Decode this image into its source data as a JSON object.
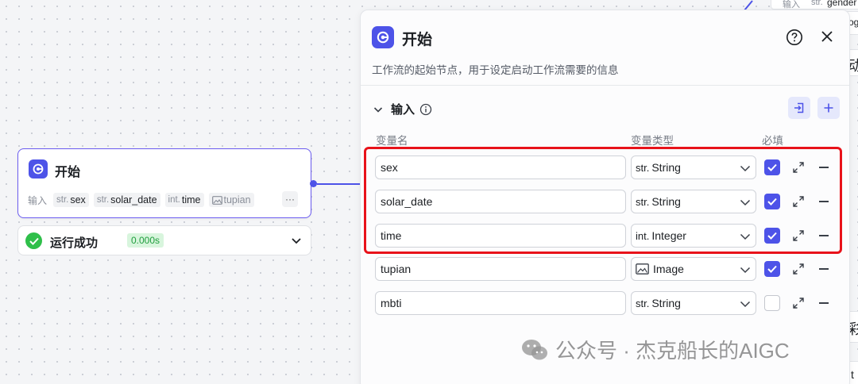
{
  "node": {
    "title": "开始",
    "inputs_label": "输入",
    "chips": [
      {
        "type": "str.",
        "name": "sex"
      },
      {
        "type": "str.",
        "name": "solar_date"
      },
      {
        "type": "int.",
        "name": "time"
      },
      {
        "type": "img",
        "name": "tupian"
      }
    ],
    "more": "···"
  },
  "status": {
    "text": "运行成功",
    "time": "0.000s"
  },
  "bg_fragments": {
    "input_label": "输入",
    "type_prefix": "str.",
    "gender": "gender",
    "og": "og",
    "char1": "动",
    "char2": "彩",
    "char3": "t"
  },
  "panel": {
    "title": "开始",
    "description": "工作流的起始节点，用于设定启动工作流需要的信息",
    "section": "输入",
    "columns": {
      "name": "变量名",
      "type": "变量类型",
      "required": "必填"
    },
    "rows": [
      {
        "name": "sex",
        "type_prefix": "str.",
        "type": "String",
        "type_icon": "string-icon",
        "required": true
      },
      {
        "name": "solar_date",
        "type_prefix": "str.",
        "type": "String",
        "type_icon": "string-icon",
        "required": true
      },
      {
        "name": "time",
        "type_prefix": "int.",
        "type": "Integer",
        "type_icon": "integer-icon",
        "required": true
      },
      {
        "name": "tupian",
        "type_prefix": "",
        "type": "Image",
        "type_icon": "image-icon",
        "required": true
      },
      {
        "name": "mbti",
        "type_prefix": "str.",
        "type": "String",
        "type_icon": "string-icon",
        "required": false
      }
    ]
  },
  "watermark": "公众号 · 杰克船长的AIGC",
  "colors": {
    "accent": "#4d53e8",
    "highlight": "#e8121a",
    "success": "#2fbf4a"
  }
}
